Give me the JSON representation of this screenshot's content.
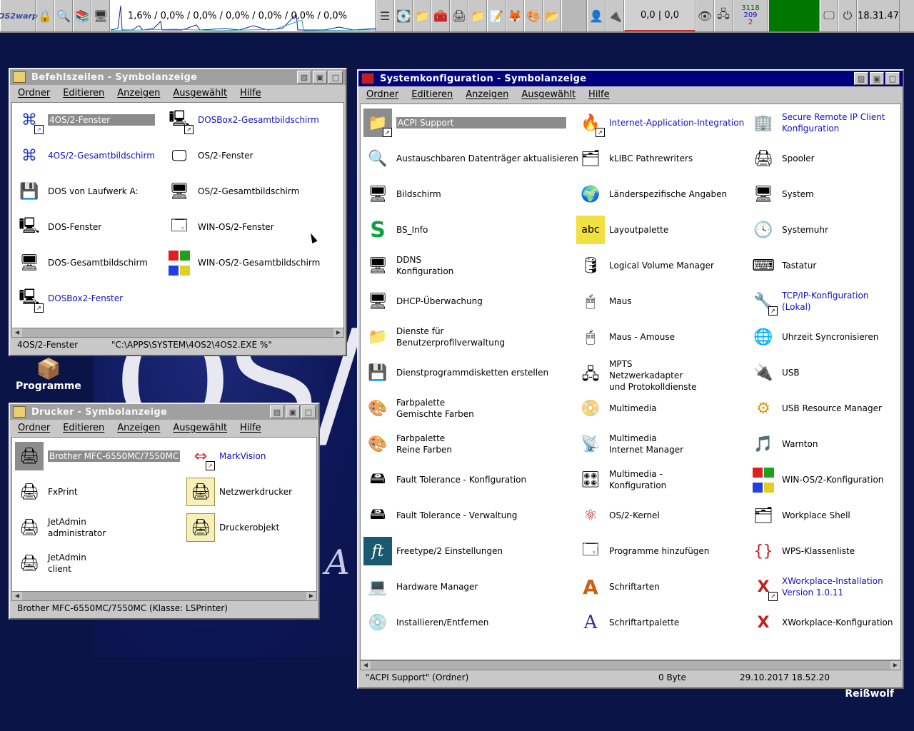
{
  "topbar": {
    "logo": "OS2warp",
    "cpu_text": "1,6% / 0,0% / 0,0% / 0,0% / 0,0% / 0,0% / 0,0%",
    "net_text": "0,0 | 0,0",
    "mem_top": "3118",
    "mem_mid": "209",
    "mem_bot": "2",
    "clock": "18.31.47",
    "icons": [
      "lock-icon",
      "search-icon",
      "books-icon",
      "monitor-icon",
      "window-list-icon",
      "drive-icon",
      "folder-icon",
      "tools-icon",
      "printer-icon",
      "folder-icon",
      "notes-icon",
      "firefox-icon",
      "paint-icon",
      "folder-icon",
      "gray-slot",
      "user-icon",
      "usb-icon",
      "eye-icon",
      "net-icon",
      "screen-icon",
      "power-icon"
    ]
  },
  "desktop": {
    "programme_label": "Programme",
    "reisswolf_label": "Reißwolf"
  },
  "befehl": {
    "title": "Befehlszeilen - Symbolanzeige",
    "menu": [
      "Ordner",
      "Editieren",
      "Anzeigen",
      "Ausgewählt",
      "Hilfe"
    ],
    "items": [
      {
        "label": "4OS/2-Fenster",
        "color": "normal"
      },
      {
        "label": "DOSBox2-Gesamtbildschirm",
        "color": "blue"
      },
      {
        "label": "4OS/2-Gesamtbildschirm",
        "color": "blue"
      },
      {
        "label": "OS/2-Fenster",
        "color": "normal"
      },
      {
        "label": "DOS von Laufwerk A:",
        "color": "normal"
      },
      {
        "label": "OS/2-Gesamtbildschirm",
        "color": "normal"
      },
      {
        "label": "DOS-Fenster",
        "color": "normal"
      },
      {
        "label": "WIN-OS/2-Fenster",
        "color": "normal"
      },
      {
        "label": "DOS-Gesamtbildschirm",
        "color": "normal"
      },
      {
        "label": "WIN-OS/2-Gesamtbildschirm",
        "color": "normal"
      },
      {
        "label": "DOSBox2-Fenster",
        "color": "blue"
      }
    ],
    "status_left": "4OS/2-Fenster",
    "status_right": "\"C:\\APPS\\SYSTEM\\4OS2\\4OS2.EXE %\""
  },
  "drucker": {
    "title": "Drucker - Symbolanzeige",
    "menu": [
      "Ordner",
      "Editieren",
      "Anzeigen",
      "Ausgewählt",
      "Hilfe"
    ],
    "items": [
      {
        "label": "Brother MFC-6550MC/7550MC"
      },
      {
        "label": "MarkVision"
      },
      {
        "label": "FxPrint"
      },
      {
        "label": "Netzwerkdrucker"
      },
      {
        "label": "JetAdmin\nadministrator"
      },
      {
        "label": "Druckerobjekt"
      },
      {
        "label": "JetAdmin\nclient"
      }
    ],
    "status": "Brother MFC-6550MC/7550MC (Klasse: LSPrinter)"
  },
  "system": {
    "title": "Systemkonfiguration - Symbolanzeige",
    "menu": [
      "Ordner",
      "Editieren",
      "Anzeigen",
      "Ausgewählt",
      "Hilfe"
    ],
    "col1": [
      "ACPI Support",
      "Austauschbaren Datenträger aktualisieren",
      "Bildschirm",
      "BS_Info",
      "DDNS\nKonfiguration",
      "DHCP-Überwachung",
      "Dienste für\nBenutzerprofilverwaltung",
      "Dienstprogrammdisketten erstellen",
      "Farbpalette\nGemischte Farben",
      "Farbpalette\nReine Farben",
      "Fault Tolerance - Konfiguration",
      "Fault Tolerance - Verwaltung",
      "Freetype/2 Einstellungen",
      "Hardware Manager",
      "Installieren/Entfernen"
    ],
    "col2": [
      "Internet-Application-Integration",
      "kLIBC Pathrewriters",
      "Länderspezifische Angaben",
      "Layoutpalette",
      "Logical Volume Manager",
      "Maus",
      "Maus - Amouse",
      "MPTS\nNetzwerkadapter\nund Protokolldienste",
      "Multimedia",
      "Multimedia\nInternet Manager",
      "Multimedia -\nKonfiguration",
      "OS/2-Kernel",
      "Programme hinzufügen",
      "Schriftarten",
      "Schriftartpalette"
    ],
    "col3": [
      "Secure Remote IP Client\nKonfiguration",
      "Spooler",
      "System",
      "Systemuhr",
      "Tastatur",
      "TCP/IP-Konfiguration\n(Lokal)",
      "Uhrzeit Syncronisieren",
      "USB",
      "USB Resource Manager",
      "Warnton",
      "WIN-OS/2-Konfiguration",
      "Workplace Shell",
      "WPS-Klassenliste",
      "XWorkplace-Installation\nVersion 1.0.11",
      "XWorkplace-Konfiguration"
    ],
    "status_name": "\"ACPI Support\" (Ordner)",
    "status_size": "0 Byte",
    "status_date": "29.10.2017 18.52.20"
  }
}
